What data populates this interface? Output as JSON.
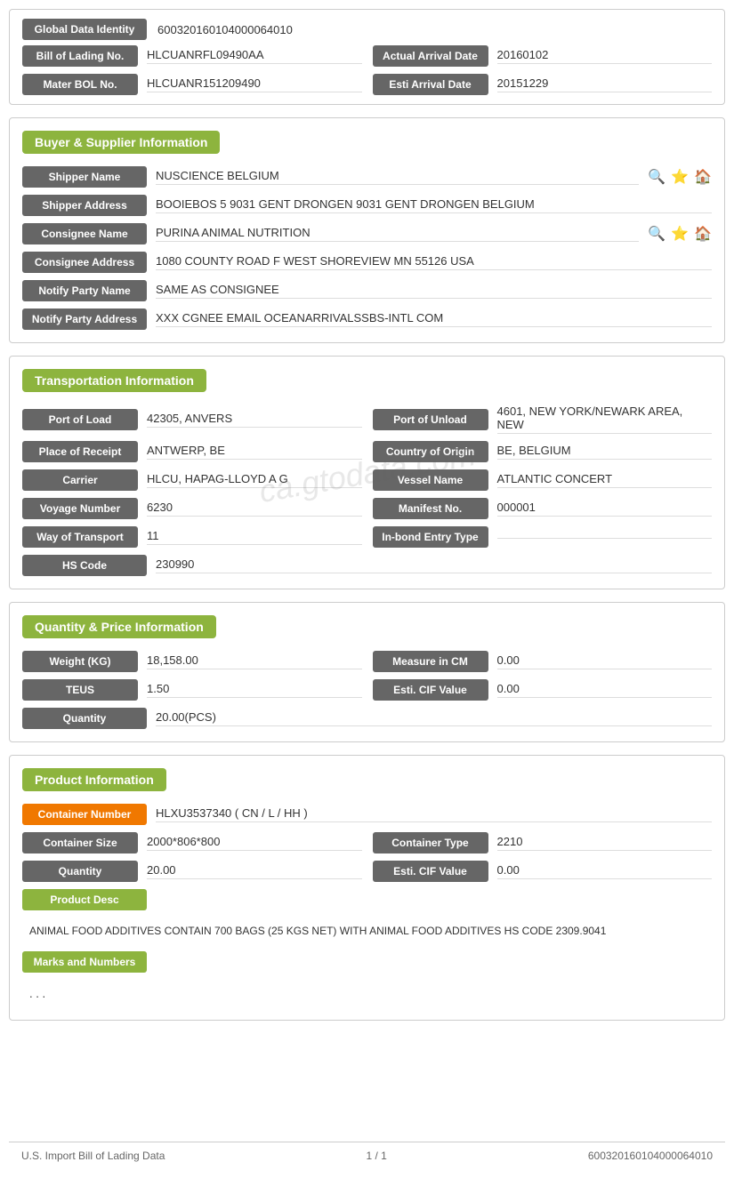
{
  "header": {
    "global_data_identity_label": "Global Data Identity",
    "global_data_identity_value": "600320160104000064010",
    "bill_of_lading_label": "Bill of Lading No.",
    "bill_of_lading_value": "HLCUANRFL09490AA",
    "actual_arrival_date_label": "Actual Arrival Date",
    "actual_arrival_date_value": "20160102",
    "mater_bol_label": "Mater BOL No.",
    "mater_bol_value": "HLCUANR151209490",
    "esti_arrival_label": "Esti Arrival Date",
    "esti_arrival_value": "20151229"
  },
  "buyer_supplier": {
    "section_title": "Buyer & Supplier Information",
    "shipper_name_label": "Shipper Name",
    "shipper_name_value": "NUSCIENCE BELGIUM",
    "shipper_address_label": "Shipper Address",
    "shipper_address_value": "BOOIEBOS 5 9031 GENT DRONGEN 9031 GENT DRONGEN BELGIUM",
    "consignee_name_label": "Consignee Name",
    "consignee_name_value": "PURINA ANIMAL NUTRITION",
    "consignee_address_label": "Consignee Address",
    "consignee_address_value": "1080 COUNTY ROAD F WEST SHOREVIEW MN 55126 USA",
    "notify_party_name_label": "Notify Party Name",
    "notify_party_name_value": "SAME AS CONSIGNEE",
    "notify_party_address_label": "Notify Party Address",
    "notify_party_address_value": "XXX CGNEE EMAIL OCEANARRIVALSSBS-INTL COM"
  },
  "transportation": {
    "section_title": "Transportation Information",
    "port_of_load_label": "Port of Load",
    "port_of_load_value": "42305, ANVERS",
    "port_of_unload_label": "Port of Unload",
    "port_of_unload_value": "4601, NEW YORK/NEWARK AREA, NEW",
    "place_of_receipt_label": "Place of Receipt",
    "place_of_receipt_value": "ANTWERP, BE",
    "country_of_origin_label": "Country of Origin",
    "country_of_origin_value": "BE, BELGIUM",
    "carrier_label": "Carrier",
    "carrier_value": "HLCU, HAPAG-LLOYD A G",
    "vessel_name_label": "Vessel Name",
    "vessel_name_value": "ATLANTIC CONCERT",
    "voyage_number_label": "Voyage Number",
    "voyage_number_value": "6230",
    "manifest_no_label": "Manifest No.",
    "manifest_no_value": "000001",
    "way_of_transport_label": "Way of Transport",
    "way_of_transport_value": "11",
    "in_bond_entry_label": "In-bond Entry Type",
    "in_bond_entry_value": "",
    "hs_code_label": "HS Code",
    "hs_code_value": "230990",
    "watermark": "ca.gtodata.com"
  },
  "quantity_price": {
    "section_title": "Quantity & Price Information",
    "weight_kg_label": "Weight (KG)",
    "weight_kg_value": "18,158.00",
    "measure_in_cm_label": "Measure in CM",
    "measure_in_cm_value": "0.00",
    "teus_label": "TEUS",
    "teus_value": "1.50",
    "esti_cif_value_label": "Esti. CIF Value",
    "esti_cif_value": "0.00",
    "quantity_label": "Quantity",
    "quantity_value": "20.00(PCS)"
  },
  "product_info": {
    "section_title": "Product Information",
    "container_number_label": "Container Number",
    "container_number_value": "HLXU3537340 ( CN / L / HH )",
    "container_size_label": "Container Size",
    "container_size_value": "2000*806*800",
    "container_type_label": "Container Type",
    "container_type_value": "2210",
    "quantity_label": "Quantity",
    "quantity_value": "20.00",
    "esti_cif_label": "Esti. CIF Value",
    "esti_cif_value": "0.00",
    "product_desc_label": "Product Desc",
    "product_desc_value": "ANIMAL FOOD ADDITIVES CONTAIN 700 BAGS (25 KGS NET) WITH ANIMAL FOOD ADDITIVES HS CODE 2309.9041",
    "marks_and_numbers_label": "Marks and Numbers",
    "marks_and_numbers_value": ". . ."
  },
  "footer": {
    "left_text": "U.S. Import Bill of Lading Data",
    "center_text": "1 / 1",
    "right_text": "600320160104000064010"
  },
  "icons": {
    "search": "🔍",
    "star": "⭐",
    "home": "🏠"
  }
}
